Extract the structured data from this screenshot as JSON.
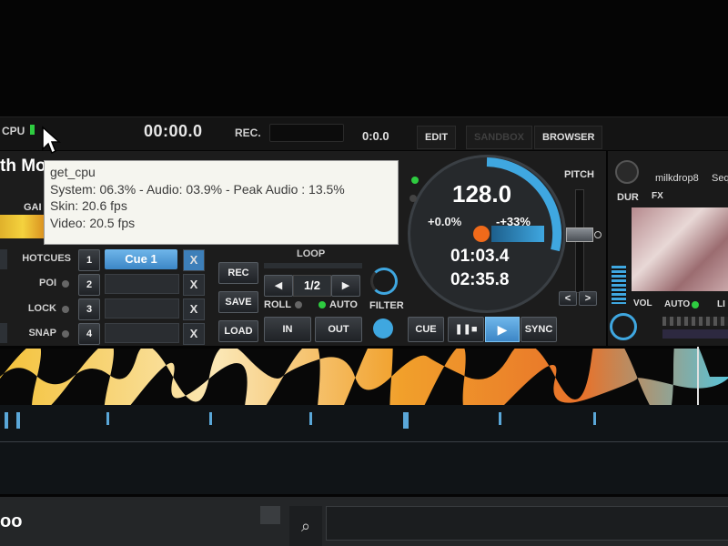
{
  "topbar": {
    "cpu_label": "CPU",
    "time": "00:00.0",
    "rec_label": "REC.",
    "time2": "0:0.0",
    "edit_label": "EDIT",
    "sandbox_label": "SANDBOX",
    "browser_label": "BROWSER"
  },
  "deck_left": {
    "title_partial": "th Mo",
    "gain_partial": "GAI",
    "hotcues_label": "HOTCUES",
    "poi_label": "POI",
    "lock_label": "LOCK",
    "snap_label": "SNAP",
    "cue_numbers": [
      "1",
      "2",
      "3",
      "4"
    ],
    "cue1_label": "Cue 1",
    "x_label": "X",
    "rec_btn": "REC",
    "save_btn": "SAVE",
    "load_btn": "LOAD",
    "loop_label": "LOOP",
    "loop_value": "1/2",
    "roll_label": "ROLL",
    "auto_label": "AUTO",
    "in_label": "IN",
    "out_label": "OUT",
    "filter_label": "FILTER",
    "cue_label": "CUE",
    "sync_label": "SYNC"
  },
  "jog": {
    "bpm": "128.0",
    "pitch_pct": "+0.0%",
    "range_pct": "-+33%",
    "elapsed": "01:03.4",
    "remaining": "02:35.8"
  },
  "pitch": {
    "label": "PITCH",
    "prev": "<",
    "next": ">"
  },
  "deck_right": {
    "dur_label": "DUR",
    "fx_label": "FX",
    "effect_name": "milkdrop8",
    "seq_partial": "Seq",
    "vol_label": "VOL",
    "auto_label": "AUTO",
    "li_partial": "LI"
  },
  "tooltip": {
    "title": "get_cpu",
    "line1": "System: 06.3% - Audio: 03.9% - Peak Audio : 13.5%",
    "line2": "Skin: 20.6 fps",
    "line3": "Video: 20.5 fps"
  },
  "bottom": {
    "left_partial": "oo"
  },
  "colors": {
    "accent_blue": "#3fa7e0",
    "led_green": "#2ecc40",
    "orange_dot": "#f06a1a",
    "tooltip_bg": "#f5f5ef"
  },
  "icons": [
    "cursor-icon",
    "search-icon",
    "play-icon",
    "pause-stop-icon",
    "arrow-left-icon",
    "arrow-right-icon"
  ]
}
